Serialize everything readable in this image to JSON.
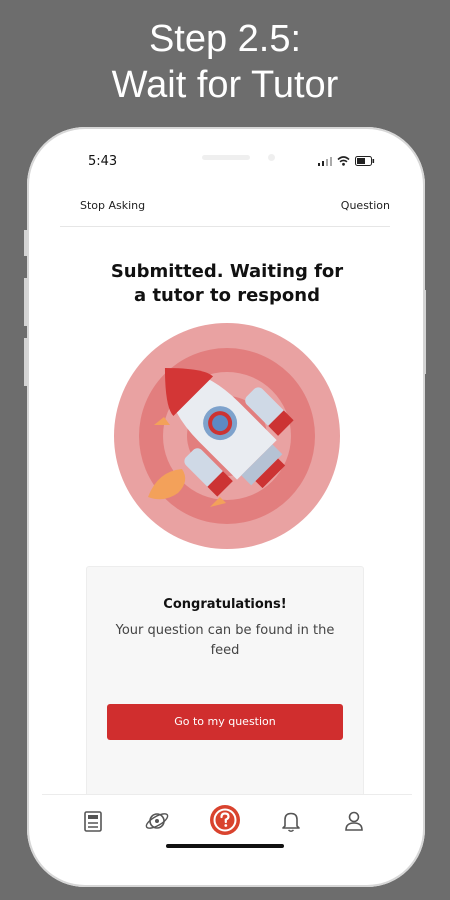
{
  "headline": {
    "line1": "Step 2.5:",
    "line2": "Wait for Tutor"
  },
  "status_bar": {
    "time": "5:43"
  },
  "top_bar": {
    "left_label": "Stop Asking",
    "right_label": "Question"
  },
  "main": {
    "title_line1": "Submitted. Waiting for",
    "title_line2": "a tutor to respond"
  },
  "card": {
    "title": "Congratulations!",
    "message": "Your question can be found in the feed",
    "button_label": "Go to my question"
  },
  "colors": {
    "accent": "#d02e2e",
    "target_ring": "#e9a2a2",
    "background": "#6d6d6d"
  },
  "nav": {
    "items": [
      "feed-icon",
      "explore-icon",
      "ask-icon",
      "notifications-icon",
      "profile-icon"
    ]
  }
}
